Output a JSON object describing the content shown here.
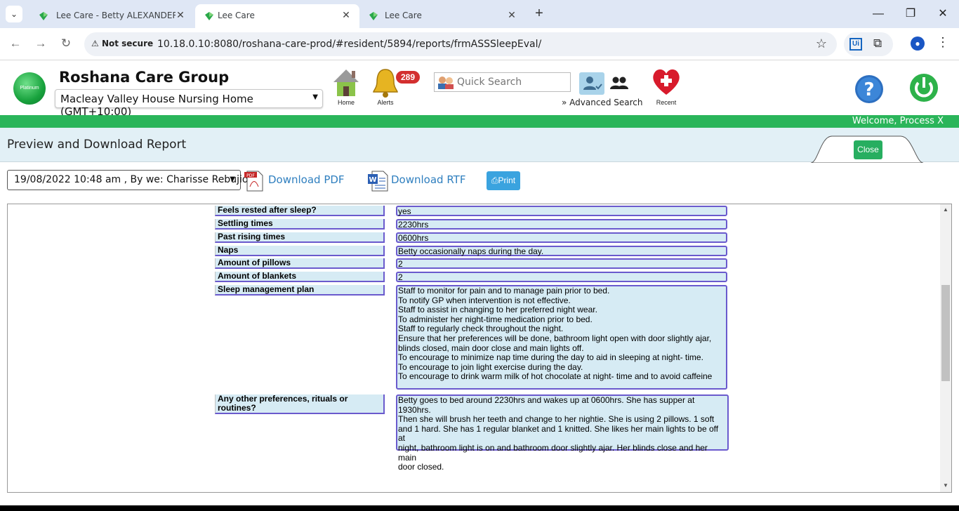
{
  "browser": {
    "tabs": [
      {
        "label": "Lee Care - Betty ALEXANDER - S",
        "active": false
      },
      {
        "label": "Lee Care",
        "active": true
      },
      {
        "label": "Lee Care",
        "active": false
      }
    ],
    "not_secure": "Not secure",
    "url": "10.18.0.10:8080/roshana-care-prod/#resident/5894/reports/frmASSSleepEval/"
  },
  "header": {
    "org_name": "Roshana Care Group",
    "logo_text": "Platinum",
    "facility": "Macleay Valley House Nursing Home (GMT+10:00)",
    "home_label": "Home",
    "alerts_label": "Alerts",
    "alerts_count": "289",
    "search_placeholder": "Quick Search",
    "advanced_search": "Advanced Search",
    "recent_label": "Recent"
  },
  "welcome": "Welcome, Process X",
  "page_title": "Preview and Download Report",
  "close_label": "Close",
  "toolbar": {
    "report_selector": "19/08/2022 10:48 am , By we: Charisse Rebujio",
    "download_pdf": "Download PDF",
    "download_rtf": "Download RTF",
    "print": "Print"
  },
  "report": {
    "rows": [
      {
        "label": "Feels rested after sleep?",
        "value": "yes"
      },
      {
        "label": "Settling times",
        "value": "2230hrs"
      },
      {
        "label": "Past rising times",
        "value": "0600hrs"
      },
      {
        "label": "Naps",
        "value": "Betty occasionally naps during the day."
      },
      {
        "label": "Amount of pillows",
        "value": "2"
      },
      {
        "label": "Amount of blankets",
        "value": "2"
      },
      {
        "label": "Sleep management plan",
        "lines": [
          "Staff to monitor for pain and to manage pain prior to bed.",
          "To notify GP when intervention is not effective.",
          "Staff to assist in changing to her preferred night wear.",
          "To administer her night-time medication prior to bed.",
          "Staff to regularly check throughout the night.",
          "Ensure that her preferences will be done, bathroom light open with door slightly ajar,",
          "blinds closed, main door close and main lights off.",
          "To encourage to minimize nap time during the day to aid in sleeping at night- time.",
          "To encourage to join light exercise during the day.",
          "To encourage to drink warm milk of hot chocolate at night- time and to avoid caffeine"
        ]
      },
      {
        "label_lines": [
          "Any other preferences, rituals or",
          "routines?"
        ],
        "lines": [
          "Betty goes to bed around 2230hrs and wakes up at 0600hrs. She has supper at 1930hrs.",
          "Then she will brush her teeth and change to her nightie. She is using 2 pillows. 1 soft",
          "and 1 hard. She has 1 regular blanket and 1 knitted. She likes her main lights to be off at",
          "night, bathroom light is on and bathroom door slightly ajar. Her blinds close and her main",
          "door closed."
        ]
      }
    ]
  }
}
